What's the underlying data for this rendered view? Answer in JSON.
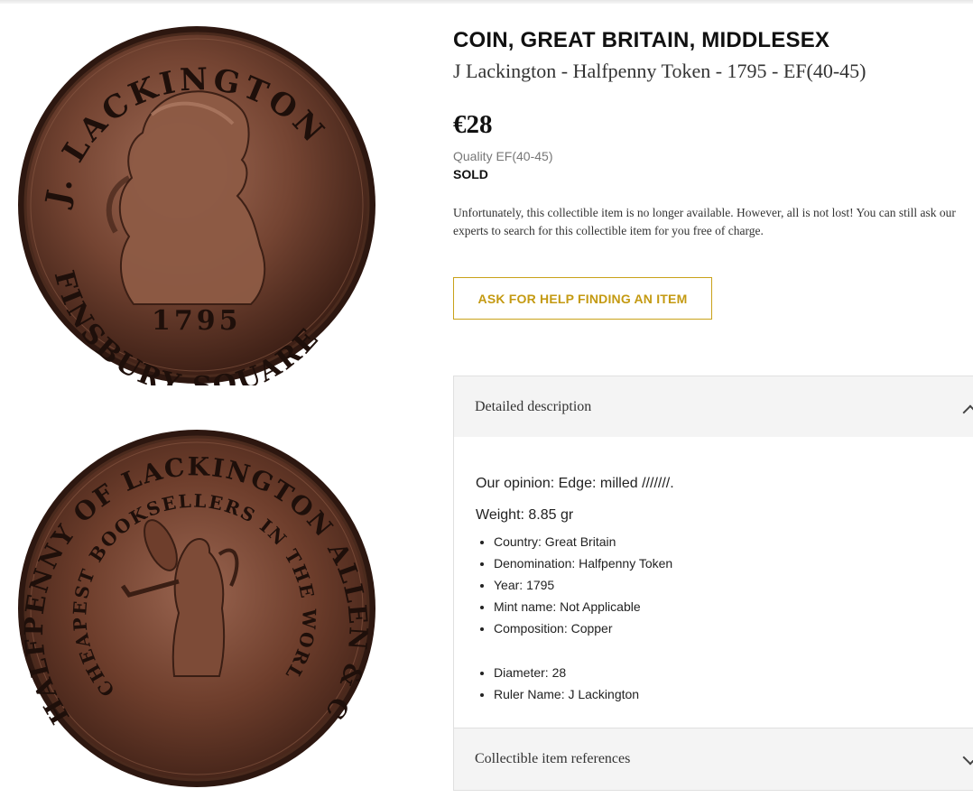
{
  "product": {
    "title": "COIN, GREAT BRITAIN, MIDDLESEX",
    "subtitle": "J Lackington - Halfpenny Token - 1795 - EF(40-45)",
    "price": "€28",
    "quality": "Quality EF(40-45)",
    "status": "SOLD",
    "notice_line1": "Unfortunately, this collectible item is no longer available. However, all is not lost! You can still ask our",
    "notice_line2": "experts to search for this collectible item for you free of charge.",
    "help_button": "ASK FOR HELP FINDING AN ITEM"
  },
  "description_panel": {
    "heading": "Detailed description",
    "opinion": "Our opinion: Edge: milled ///////.",
    "weight": "Weight: 8.85 gr",
    "attributes": [
      "Country: Great Britain",
      "Denomination: Halfpenny Token",
      "Year: 1795",
      "Mint name: Not Applicable",
      "Composition: Copper"
    ],
    "attributes_extra": [
      "Diameter: 28",
      "Ruler Name: J Lackington"
    ]
  },
  "references_panel": {
    "heading": "Collectible item references"
  },
  "coin": {
    "obverse_legend_top": "J. LACKINGTON",
    "obverse_legend_bottom": "FINSBURY SQUARE",
    "obverse_date": "1795",
    "reverse_legend_outer": "HALFPENNY OF LACKINGTON ALLEN & CO",
    "reverse_legend_inner": "CHEAPEST BOOKSELLERS IN THE WORLD",
    "colors": {
      "copper_dark": "#3e2016",
      "copper_mid": "#6e3e2c",
      "copper_light": "#a06b55"
    }
  },
  "colors": {
    "accent": "#c9a21a",
    "panel_bg": "#f4f4f4"
  }
}
